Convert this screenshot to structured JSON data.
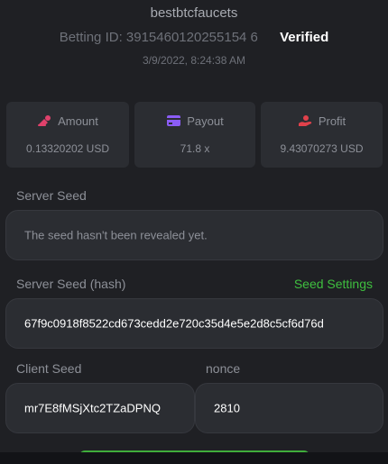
{
  "header": {
    "username": "bestbtcfaucets",
    "betting_id_label": "Betting ID: 3915460120255154 6",
    "verified_label": "Verified",
    "timestamp": "3/9/2022, 8:24:38 AM"
  },
  "stats": [
    {
      "label": "Amount",
      "value": "0.13320202 USD",
      "icon": "coins-icon",
      "icon_color": "#e0416b"
    },
    {
      "label": "Payout",
      "value": "71.8 x",
      "icon": "card-icon",
      "icon_color": "#8b5cf6"
    },
    {
      "label": "Profit",
      "value": "9.43070273 USD",
      "icon": "hand-money-icon",
      "icon_color": "#e0414b"
    }
  ],
  "server_seed": {
    "label": "Server Seed",
    "value": "The seed hasn't been revealed yet."
  },
  "server_seed_hash": {
    "label": "Server Seed (hash)",
    "value": "67f9c0918f8522cd673cedd2e720c35d4e5e2d8c5cf6d76d",
    "settings_link": "Seed Settings"
  },
  "client_seed": {
    "label": "Client Seed",
    "value": "mr7E8fMSjXtc2TZaDPNQ"
  },
  "nonce": {
    "label": "nonce",
    "value": "2810"
  },
  "colors": {
    "background": "#1f2024",
    "card": "#2b2d32",
    "accent_green": "#3fbf3f"
  }
}
